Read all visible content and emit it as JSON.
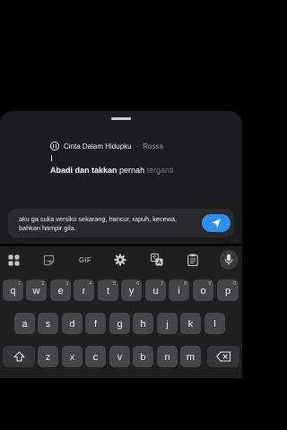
{
  "music": {
    "title": "Cinta Dalam Hidupku",
    "separator": "·",
    "artist": "Rossa",
    "lyric_done": "Abadi dan takkan",
    "lyric_mid": "pernah",
    "lyric_todo": "terganti"
  },
  "composer": {
    "text": "aku ga suka versiku sekarang, hancur, rapuh, kecewa, bahkan hampir gila."
  },
  "toolbar": {
    "gif_label": "GIF"
  },
  "keyboard": {
    "row1": [
      {
        "k": "q",
        "n": "1"
      },
      {
        "k": "w",
        "n": "2"
      },
      {
        "k": "e",
        "n": "3"
      },
      {
        "k": "r",
        "n": "4"
      },
      {
        "k": "t",
        "n": "5"
      },
      {
        "k": "y",
        "n": "6"
      },
      {
        "k": "u",
        "n": "7"
      },
      {
        "k": "i",
        "n": "8"
      },
      {
        "k": "o",
        "n": "9"
      },
      {
        "k": "p",
        "n": "0"
      }
    ],
    "row2": [
      "a",
      "s",
      "d",
      "f",
      "g",
      "h",
      "j",
      "k",
      "l"
    ],
    "row3": [
      "z",
      "x",
      "c",
      "v",
      "b",
      "n",
      "m"
    ]
  },
  "colors": {
    "accent": "#2f8ff0",
    "key": "#464649",
    "key_fn": "#353538"
  }
}
